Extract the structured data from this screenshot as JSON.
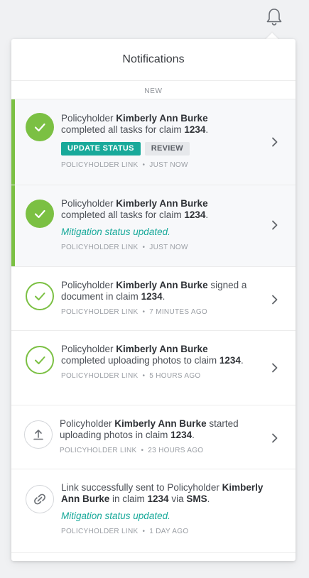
{
  "header": {
    "bell_icon": "bell-icon"
  },
  "panel": {
    "title": "Notifications",
    "section_label": "NEW"
  },
  "colors": {
    "accent_green": "#7bc043",
    "teal": "#18a99a"
  },
  "notifications": [
    {
      "icon": "check-circle-filled-icon",
      "prefix": "Policyholder ",
      "name": "Kimberly Ann Burke",
      "text2": "completed all tasks for claim ",
      "claim": "1234",
      "suffix": ".",
      "actions": {
        "primary": "UPDATE STATUS",
        "secondary": "REVIEW"
      },
      "source": "POLICYHOLDER LINK",
      "time": "JUST NOW"
    },
    {
      "icon": "check-circle-filled-icon",
      "prefix": "Policyholder ",
      "name": "Kimberly Ann Burke",
      "text2": "completed all tasks for claim ",
      "claim": "1234",
      "suffix": ".",
      "note": "Mitigation status updated.",
      "source": "POLICYHOLDER LINK",
      "time": "JUST NOW"
    },
    {
      "icon": "check-circle-outline-icon",
      "prefix": "Policyholder ",
      "name": "Kimberly Ann Burke",
      "text2": " signed a document in claim ",
      "claim": "1234",
      "suffix": ".",
      "source": "POLICYHOLDER LINK",
      "time": "7 MINUTES AGO"
    },
    {
      "icon": "check-circle-outline-icon",
      "prefix": "Policyholder ",
      "name": "Kimberly Ann Burke",
      "text2": "completed uploading photos to claim ",
      "claim": "1234",
      "suffix": ".",
      "source": "POLICYHOLDER LINK",
      "time": "5 HOURS AGO"
    },
    {
      "icon": "upload-icon",
      "prefix": "Policyholder ",
      "name": "Kimberly Ann Burke",
      "text2": " started uploading photos in claim ",
      "claim": "1234",
      "suffix": ".",
      "source": "POLICYHOLDER LINK",
      "time": "23 HOURS AGO"
    },
    {
      "icon": "link-icon",
      "prefix": "Link successfully sent to Policyholder ",
      "name": "Kimberly Ann Burke",
      "text2": " in claim ",
      "claim": "1234",
      "text3": " via ",
      "channel": "SMS",
      "suffix": ".",
      "note": "Mitigation status updated.",
      "source": "POLICYHOLDER LINK",
      "time": "1 DAY AGO"
    }
  ]
}
